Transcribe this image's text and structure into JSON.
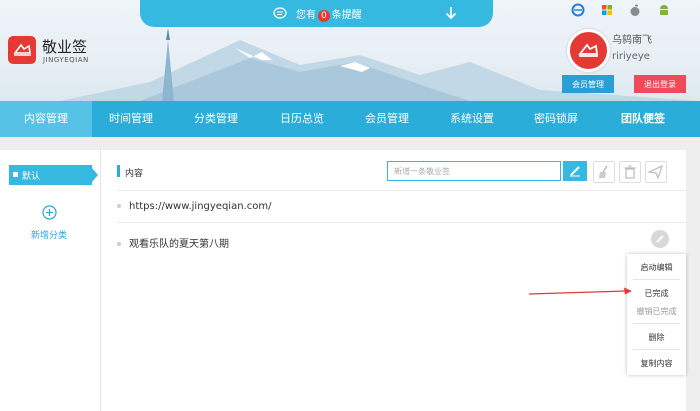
{
  "notification": {
    "prefix": "您有",
    "count": "0",
    "suffix": "条提醒"
  },
  "logo": {
    "name": "敬业签",
    "pinyin": "JINGYEQIAN"
  },
  "user": {
    "name": "乌鸫南飞",
    "id": "ririyeye"
  },
  "header_buttons": {
    "member": "会员管理",
    "logout": "退出登录"
  },
  "nav": [
    {
      "label": "内容管理",
      "active": true
    },
    {
      "label": "时间管理"
    },
    {
      "label": "分类管理"
    },
    {
      "label": "日历总览"
    },
    {
      "label": "会员管理"
    },
    {
      "label": "系统设置"
    },
    {
      "label": "密码锁屏"
    },
    {
      "label": "团队便签",
      "bold": true
    }
  ],
  "sidebar": {
    "items": [
      {
        "label": "默认"
      }
    ],
    "add_label": "新增分类"
  },
  "content": {
    "section_title": "内容",
    "new_placeholder": "新增一条敬业签",
    "notes": [
      {
        "text": "https://www.jingyeqian.com/"
      },
      {
        "text": "观看乐队的夏天第八期"
      }
    ]
  },
  "context_menu": {
    "items": [
      "启动编辑",
      "已完成",
      "撤销已完成",
      "删除",
      "复制内容"
    ]
  },
  "colors": {
    "accent": "#2aaed9",
    "danger": "#e53935",
    "button_blue": "#2a9fd6",
    "button_red": "#f04a5a"
  }
}
